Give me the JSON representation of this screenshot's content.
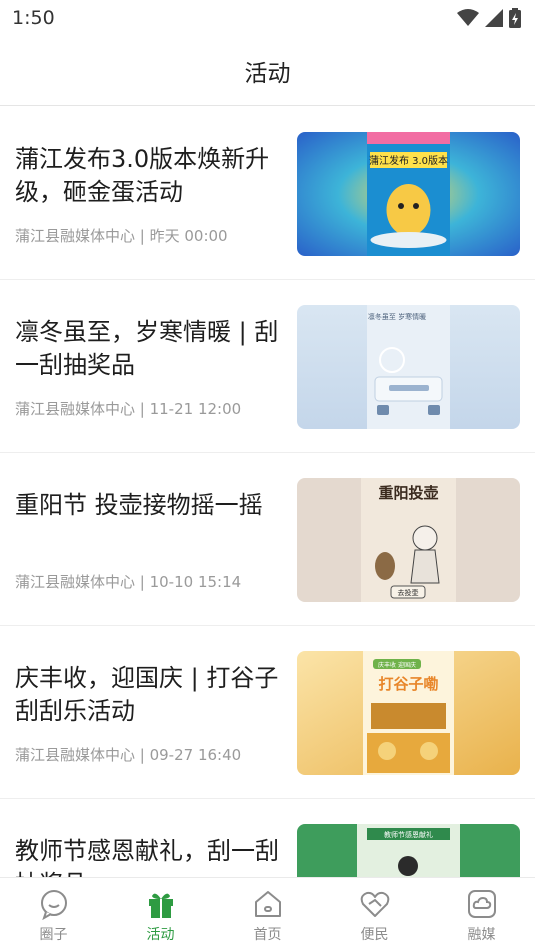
{
  "status_bar": {
    "time": "1:50"
  },
  "header": {
    "title": "活动"
  },
  "feed": [
    {
      "title": "蒲江发布3.0版本焕新升级，砸金蛋活动",
      "meta": "蒲江县融媒体中心 | 昨天 00:00",
      "thumb_text": "蒲江发布 3.0版本"
    },
    {
      "title": "凛冬虽至，岁寒情暖 | 刮一刮抽奖品",
      "meta": "蒲江县融媒体中心 | 11-21 12:00",
      "thumb_text": "凛冬虽至 岁寒情暖"
    },
    {
      "title": "重阳节 投壶接物摇一摇",
      "meta": "蒲江县融媒体中心 | 10-10 15:14",
      "thumb_text": "重阳投壶",
      "thumb_text2": "去投壶"
    },
    {
      "title": "庆丰收，迎国庆 | 打谷子刮刮乐活动",
      "meta": "蒲江县融媒体中心 | 09-27 16:40",
      "thumb_text": "打谷子嘞",
      "thumb_text2": "庆丰收 迎国庆"
    },
    {
      "title": "教师节感恩献礼，刮一刮抽奖品",
      "meta": "",
      "thumb_text": "教师节感恩献礼"
    }
  ],
  "tabs": [
    {
      "label": "圈子",
      "icon": "chat-bubble-icon",
      "active": false
    },
    {
      "label": "活动",
      "icon": "gift-icon",
      "active": true
    },
    {
      "label": "首页",
      "icon": "home-icon",
      "active": false
    },
    {
      "label": "便民",
      "icon": "heart-hands-icon",
      "active": false
    },
    {
      "label": "融媒",
      "icon": "cloud-box-icon",
      "active": false
    }
  ],
  "colors": {
    "accent": "#2e9b42",
    "inactive": "#8c8c8c"
  }
}
